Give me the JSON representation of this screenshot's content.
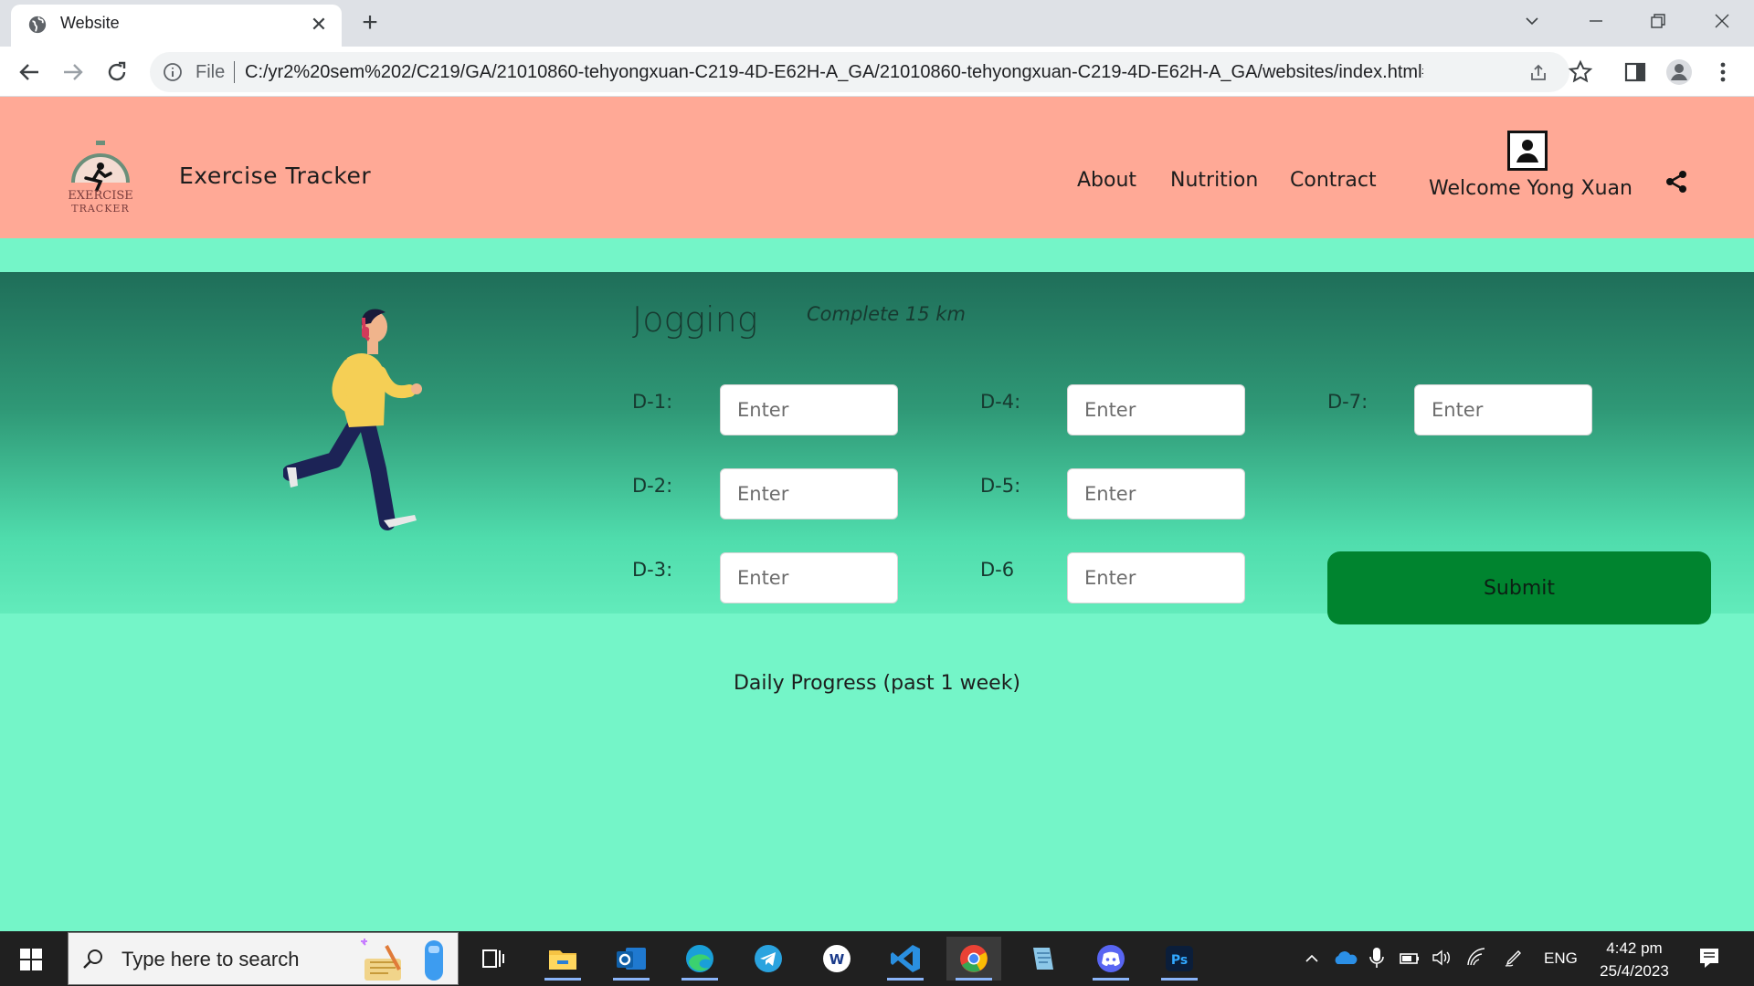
{
  "browser": {
    "tab_title": "Website",
    "tab_close": "✕",
    "new_tab": "+",
    "omnibox_scheme": "File",
    "url": "C:/yr2%20sem%202/C219/GA/21010860-tehyongxuan-C219-4D-E62H-A_GA/21010860-tehyongxuan-C219-4D-E62H-A_GA/websites/index.html#se..."
  },
  "header": {
    "logo_text_top": "EXERCISE",
    "logo_text_bottom": "TRACKER",
    "brand": "Exercise Tracker",
    "nav": [
      "About",
      "Nutrition",
      "Contract"
    ],
    "welcome": "Welcome Yong Xuan"
  },
  "exercise": {
    "title": "Jogging",
    "goal": "Complete 15 km",
    "days": [
      {
        "label": "D-1:",
        "placeholder": "Enter",
        "value": ""
      },
      {
        "label": "D-2:",
        "placeholder": "Enter",
        "value": ""
      },
      {
        "label": "D-3:",
        "placeholder": "Enter",
        "value": ""
      },
      {
        "label": "D-4:",
        "placeholder": "Enter",
        "value": ""
      },
      {
        "label": "D-5:",
        "placeholder": "Enter",
        "value": ""
      },
      {
        "label": "D-6",
        "placeholder": "Enter",
        "value": ""
      },
      {
        "label": "D-7:",
        "placeholder": "Enter",
        "value": ""
      }
    ],
    "submit_label": "Submit"
  },
  "progress": {
    "title": "Daily Progress (past 1 week)"
  },
  "taskbar": {
    "search_placeholder": "Type here to search",
    "language": "ENG",
    "time": "4:42 pm",
    "date": "25/4/2023",
    "apps": [
      "task-view",
      "file-explorer",
      "outlook",
      "edge",
      "telegram",
      "app-w",
      "vscode",
      "chrome",
      "notepad",
      "discord",
      "photoshop"
    ]
  },
  "colors": {
    "header_bg": "#ffa996",
    "page_bg": "#74f5c8",
    "panel_top": "#1f6e59",
    "submit_bg": "#00842f"
  }
}
